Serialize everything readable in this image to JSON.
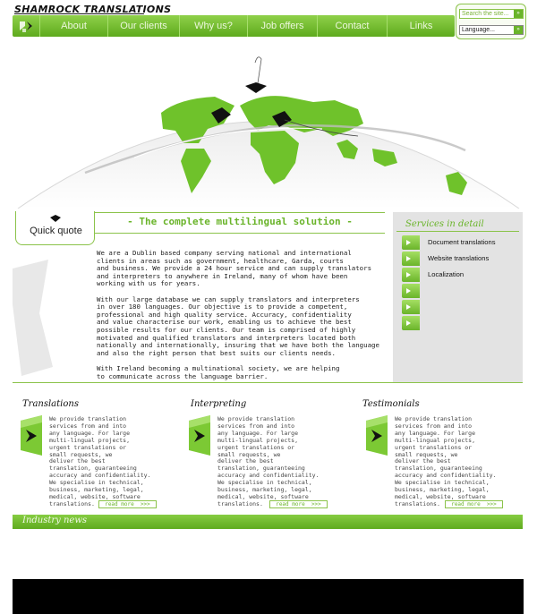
{
  "brand": {
    "logo_text": "SHAMROCK TRANSLATIONS"
  },
  "nav": {
    "items": [
      {
        "label": "About"
      },
      {
        "label": "Our clients"
      },
      {
        "label": "Why us?"
      },
      {
        "label": "Job offers"
      },
      {
        "label": "Contact"
      },
      {
        "label": "Links"
      }
    ]
  },
  "search": {
    "placeholder": "Search the site...",
    "go_label": "»"
  },
  "language": {
    "selected": "Language...",
    "go_label": "»"
  },
  "quick_quote": {
    "label": "Quick quote"
  },
  "main": {
    "title": "-  The complete multilingual solution  -",
    "paragraphs": [
      "We are a Dublin based company serving national and international\nclients in areas such as government, healthcare, Garda, courts\nand business. We provide a 24 hour service and can supply translators\nand interpreters to anywhere in Ireland, many of whom have been\nworking with us for years.",
      "With our large database we can supply translators and interpreters\nin over 180 languages. Our objective is to provide a competent,\nprofessional and high quality service. Accuracy, confidentiality\nand value characterise our work, enabling us to achieve the best\npossible results for our clients. Our team is comprised of highly\nmotivated and qualified translators and interpreters located both\nnationally and internationally, insuring that we have both the language\nand also the right person that best suits our clients needs.",
      "With Ireland becoming a multinational society, we are helping\nto communicate across the language barrier."
    ]
  },
  "services": {
    "title": "Services in detail",
    "items": [
      {
        "label": "Document translations"
      },
      {
        "label": "Website translations"
      },
      {
        "label": "Localization"
      },
      {
        "label": ""
      },
      {
        "label": ""
      },
      {
        "label": ""
      }
    ]
  },
  "columns": [
    {
      "title": "Translations",
      "text": "We provide translation\nservices from and into\nany language. For large\nmulti-lingual projects,\nurgent translations or\nsmall requests, we\ndeliver the best\ntranslation, guaranteeing\naccuracy and confidentiality.\nWe specialise in technical,\nbusiness, marketing, legal,\nmedical, website, software\ntranslations.",
      "read_more": "read more  >>>"
    },
    {
      "title": "Interpreting",
      "text": "We provide translation\nservices from and into\nany language. For large\nmulti-lingual projects,\nurgent translations or\nsmall requests, we\ndeliver the best\ntranslation, guaranteeing\naccuracy and confidentiality.\nWe specialise in technical,\nbusiness, marketing, legal,\nmedical, website, software\ntranslations.",
      "read_more": "read more  >>>"
    },
    {
      "title": "Testimonials",
      "text": "We provide translation\nservices from and into\nany language. For large\nmulti-lingual projects,\nurgent translations or\nsmall requests, we\ndeliver the best\ntranslation, guaranteeing\naccuracy and confidentiality.\nWe specialise in technical,\nbusiness, marketing, legal,\nmedical, website, software\ntranslations.",
      "read_more": "read more  >>>"
    }
  ],
  "news": {
    "title": "Industry news"
  },
  "colors": {
    "accent": "#6ab42a",
    "accent_light": "#8fd14a",
    "panel_gray": "#e3e3e3",
    "footer": "#000000"
  }
}
